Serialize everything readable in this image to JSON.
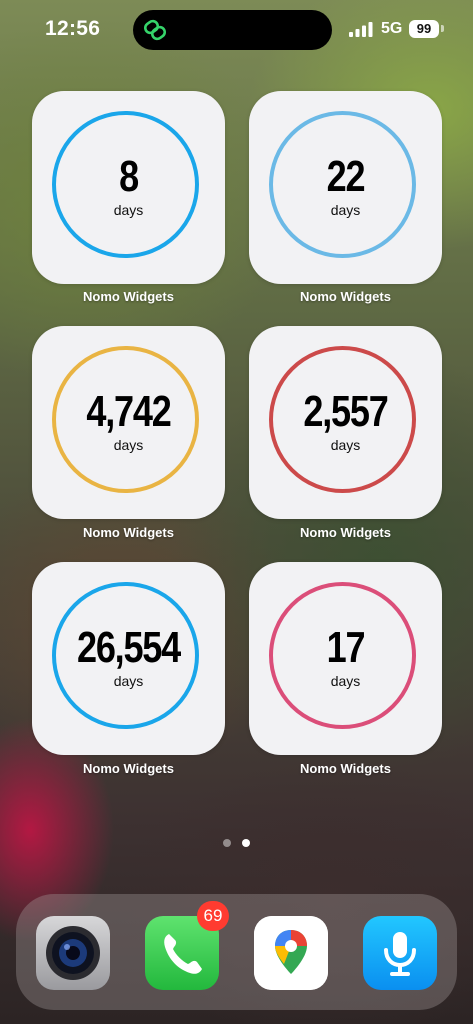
{
  "status_bar": {
    "time": "12:56",
    "network": "5G",
    "battery": "99",
    "island_icon": "link-icon"
  },
  "widgets": [
    {
      "count": "8",
      "unit": "days",
      "label": "Nomo Widgets",
      "ring_color": "#1aa6ea"
    },
    {
      "count": "22",
      "unit": "days",
      "label": "Nomo Widgets",
      "ring_color": "#6bb9e6"
    },
    {
      "count": "4,742",
      "unit": "days",
      "label": "Nomo Widgets",
      "ring_color": "#e9b443"
    },
    {
      "count": "2,557",
      "unit": "days",
      "label": "Nomo Widgets",
      "ring_color": "#cc4a4a"
    },
    {
      "count": "26,554",
      "unit": "days",
      "label": "Nomo Widgets",
      "ring_color": "#1aa6ea"
    },
    {
      "count": "17",
      "unit": "days",
      "label": "Nomo Widgets",
      "ring_color": "#db4e79"
    }
  ],
  "page_indicator": {
    "pages": 2,
    "current": 2
  },
  "dock": {
    "apps": [
      {
        "icon": "camera-icon"
      },
      {
        "icon": "phone-icon",
        "badge": "69"
      },
      {
        "icon": "maps-icon"
      },
      {
        "icon": "voice-memos-icon"
      }
    ]
  }
}
